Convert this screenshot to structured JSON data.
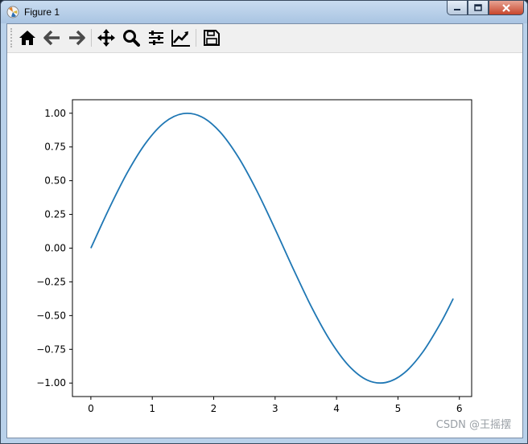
{
  "window": {
    "title": "Figure 1",
    "title_color": "#000000",
    "controls": [
      "minimize-icon",
      "maximize-icon",
      "close-icon"
    ]
  },
  "toolbar": {
    "buttons": [
      {
        "name": "home",
        "icon": "home-icon"
      },
      {
        "name": "back",
        "icon": "arrow-left-icon"
      },
      {
        "name": "forward",
        "icon": "arrow-right-icon"
      },
      {
        "name": "pan",
        "icon": "move-icon"
      },
      {
        "name": "zoom",
        "icon": "magnifier-icon"
      },
      {
        "name": "configure-subplots",
        "icon": "sliders-icon"
      },
      {
        "name": "edit-axis",
        "icon": "line-chart-icon"
      },
      {
        "name": "save",
        "icon": "floppy-disk-icon"
      }
    ]
  },
  "watermark": "CSDN @王摇摆",
  "chart_data": {
    "type": "line",
    "title": "",
    "xlabel": "",
    "ylabel": "",
    "xlim": [
      -0.3,
      6.2
    ],
    "ylim": [
      -1.1,
      1.1
    ],
    "x_ticks": [
      "0",
      "1",
      "2",
      "3",
      "4",
      "5",
      "6"
    ],
    "y_ticks": [
      "1.00",
      "0.75",
      "0.50",
      "0.25",
      "0.00",
      "−0.25",
      "−0.50",
      "−0.75",
      "−1.00"
    ],
    "grid": false,
    "line_color": "#1f77b4",
    "series": [
      {
        "x": [
          0,
          0.3,
          0.6,
          0.9,
          1.2,
          1.5,
          1.8,
          2.1,
          2.4,
          2.7,
          3.0,
          3.3,
          3.6,
          3.9,
          4.2,
          4.5,
          4.8,
          5.1,
          5.4,
          5.7,
          5.9
        ],
        "values": [
          0.0,
          0.296,
          0.565,
          0.783,
          0.932,
          0.997,
          0.974,
          0.863,
          0.675,
          0.427,
          0.141,
          -0.158,
          -0.443,
          -0.688,
          -0.872,
          -0.978,
          -0.996,
          -0.926,
          -0.773,
          -0.551,
          -0.374
        ]
      }
    ]
  }
}
